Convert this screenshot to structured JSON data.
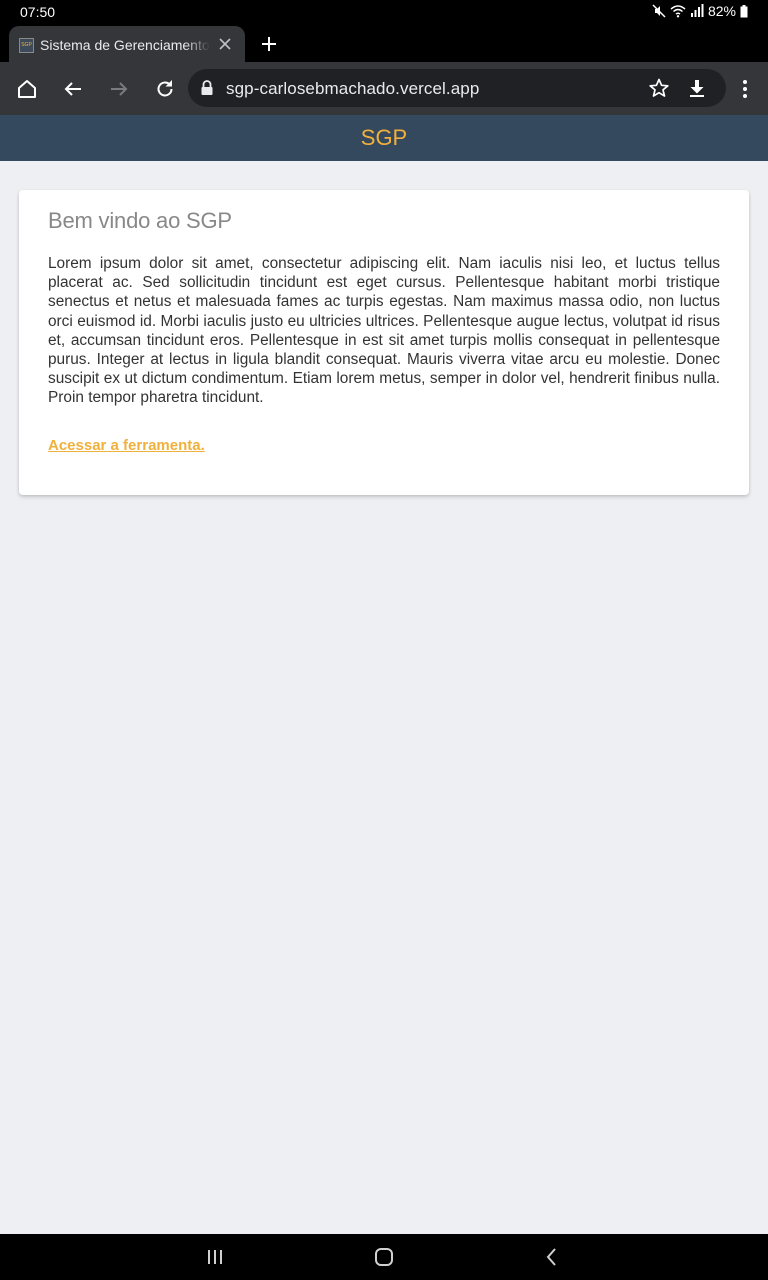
{
  "status_bar": {
    "time": "07:50",
    "battery": "82%",
    "icons": [
      "mute-icon",
      "wifi-icon",
      "signal-icon",
      "battery-icon"
    ]
  },
  "browser": {
    "tab": {
      "title": "Sistema de Gerenciamento de Projetos",
      "favicon_text": "SGP"
    },
    "url": "sgp-carlosebmachado.vercel.app"
  },
  "app": {
    "brand": "SGP",
    "card": {
      "title": "Bem vindo ao SGP",
      "body": "Lorem ipsum dolor sit amet, consectetur adipiscing elit. Nam iaculis nisi leo, et luctus tellus placerat ac. Sed sollicitudin tincidunt est eget cursus. Pellentesque habitant morbi tristique senectus et netus et malesuada fames ac turpis egestas. Nam maximus massa odio, non luctus orci euismod id. Morbi iaculis justo eu ultricies ultrices. Pellentesque augue lectus, volutpat id risus et, accumsan tincidunt eros. Pellentesque in est sit amet turpis mollis consequat in pellentesque purus. Integer at lectus in ligula blandit consequat. Mauris viverra vitae arcu eu molestie. Donec suscipit ex ut dictum condimentum. Etiam lorem metus, semper in dolor vel, hendrerit finibus nulla. Proin tempor pharetra tincidunt.",
      "link": "Acessar a ferramenta."
    }
  },
  "colors": {
    "accent": "#f0b03c",
    "header_bg": "#34495e",
    "page_bg": "#edeff2"
  }
}
